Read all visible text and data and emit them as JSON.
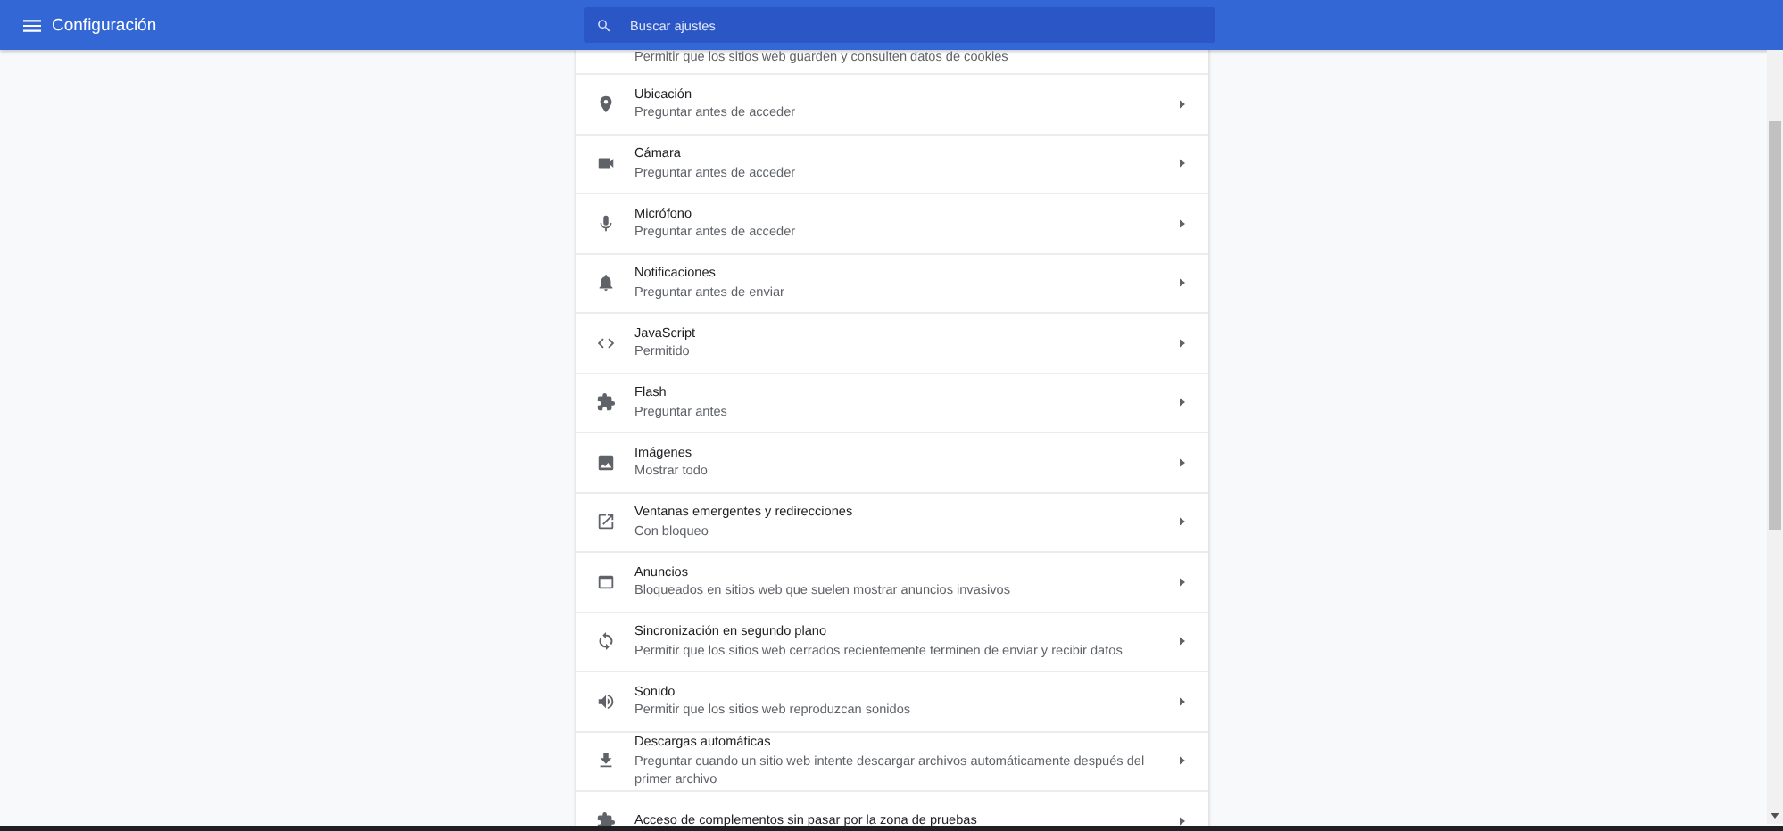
{
  "header": {
    "title": "Configuración",
    "search": {
      "placeholder": "Buscar ajustes"
    }
  },
  "settings": [
    {
      "kind": "none",
      "subtitle": "Permitir que los sitios web guarden y consulten datos de cookies"
    },
    {
      "kind": "pin",
      "title": "Ubicación",
      "subtitle": "Preguntar antes de acceder"
    },
    {
      "kind": "camera",
      "title": "Cámara",
      "subtitle": "Preguntar antes de acceder"
    },
    {
      "kind": "mic",
      "title": "Micrófono",
      "subtitle": "Preguntar antes de acceder"
    },
    {
      "kind": "bell",
      "title": "Notificaciones",
      "subtitle": "Preguntar antes de enviar"
    },
    {
      "kind": "code",
      "title": "JavaScript",
      "subtitle": "Permitido"
    },
    {
      "kind": "puzzle",
      "title": "Flash",
      "subtitle": "Preguntar antes"
    },
    {
      "kind": "image",
      "title": "Imágenes",
      "subtitle": "Mostrar todo"
    },
    {
      "kind": "popup",
      "title": "Ventanas emergentes y redirecciones",
      "subtitle": "Con bloqueo"
    },
    {
      "kind": "window",
      "title": "Anuncios",
      "subtitle": "Bloqueados en sitios web que suelen mostrar anuncios invasivos"
    },
    {
      "kind": "sync",
      "title": "Sincronización en segundo plano",
      "subtitle": "Permitir que los sitios web cerrados recientemente terminen de enviar y recibir datos"
    },
    {
      "kind": "sound",
      "title": "Sonido",
      "subtitle": "Permitir que los sitios web reproduzcan sonidos"
    },
    {
      "kind": "download",
      "title": "Descargas automáticas",
      "subtitle": "Preguntar cuando un sitio web intente descargar archivos automáticamente después del primer archivo"
    },
    {
      "kind": "puzzle",
      "title": "Acceso de complementos sin pasar por la zona de pruebas"
    }
  ]
}
